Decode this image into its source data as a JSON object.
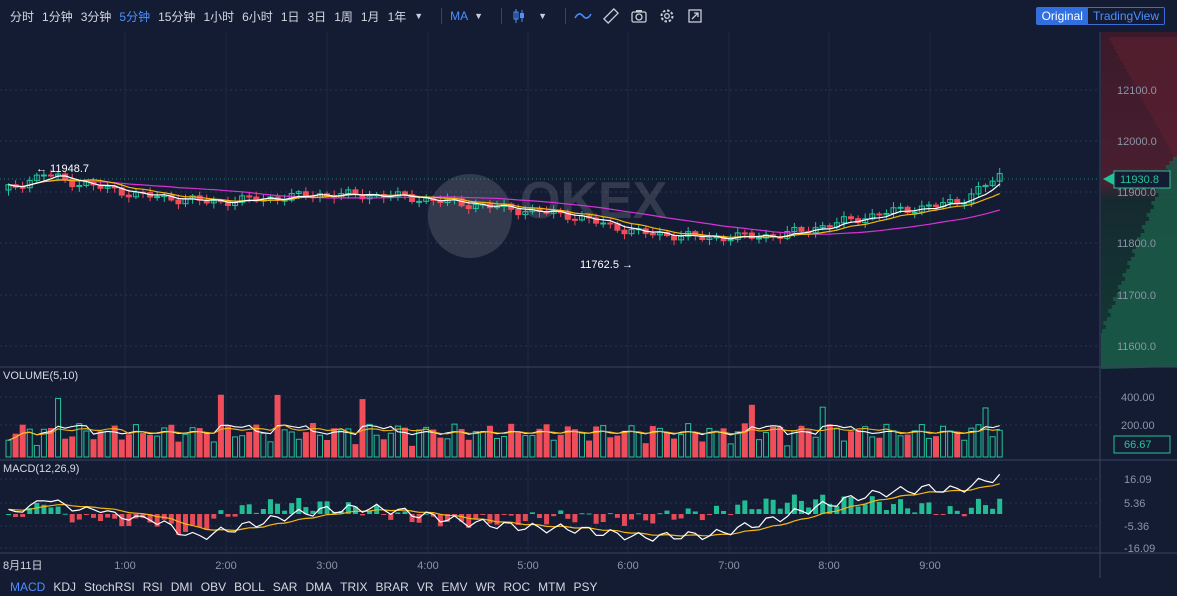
{
  "toolbar": {
    "timeframes": [
      "分时",
      "1分钟",
      "3分钟",
      "5分钟",
      "15分钟",
      "1小时",
      "6小时",
      "1日",
      "3日",
      "1周",
      "1月",
      "1年"
    ],
    "active_timeframe": "5分钟",
    "indicator_menu": "MA",
    "view_original": "Original",
    "view_tradingview": "TradingView"
  },
  "watermark": "OKEX",
  "colors": {
    "up": "#22c49a",
    "down": "#f04d5a",
    "ma_white": "#ffffff",
    "ma_yellow": "#f5b70f",
    "ma_magenta": "#d633d6",
    "accent": "#4d8fff"
  },
  "main": {
    "high_label": "11948.7",
    "low_label": "11762.5",
    "last_price": "11930.8",
    "price_ticks": [
      "12100.0",
      "12000.0",
      "11900.0",
      "11800.0",
      "11700.0",
      "11600.0"
    ]
  },
  "volume": {
    "title": "VOLUME(5,10)",
    "ticks": [
      "400.00",
      "200.00"
    ],
    "last_value": "66.67"
  },
  "macd": {
    "title": "MACD(12,26,9)",
    "ticks": [
      "16.09",
      "5.36",
      "-5.36",
      "-16.09"
    ]
  },
  "time_axis": {
    "first": "8月11日",
    "labels": [
      "1:00",
      "2:00",
      "3:00",
      "4:00",
      "5:00",
      "6:00",
      "7:00",
      "8:00",
      "9:00"
    ]
  },
  "indicators": [
    "MACD",
    "KDJ",
    "StochRSI",
    "RSI",
    "DMI",
    "OBV",
    "BOLL",
    "SAR",
    "DMA",
    "TRIX",
    "BRAR",
    "VR",
    "EMV",
    "WR",
    "ROC",
    "MTM",
    "PSY"
  ],
  "active_indicator": "MACD"
}
